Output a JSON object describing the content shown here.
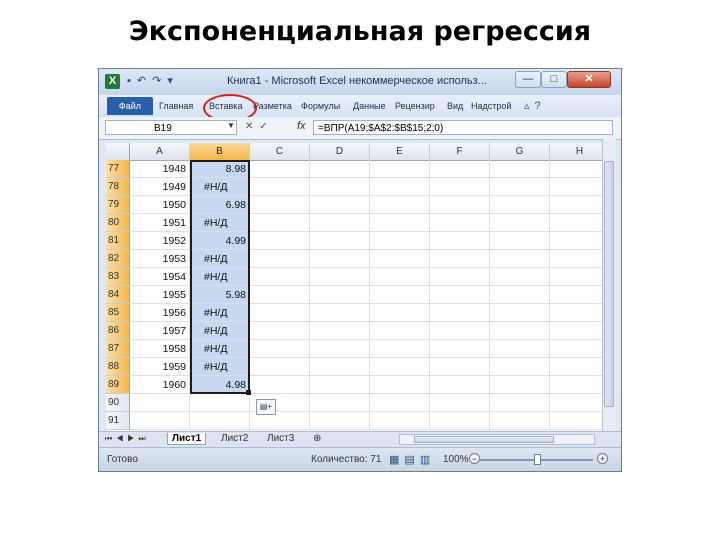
{
  "slide": {
    "title": "Экспоненциальная регрессия"
  },
  "window": {
    "title": "Книга1 - Microsoft Excel некоммерческое использ...",
    "app_icon": "excel-icon",
    "quick_access": [
      "save-icon",
      "undo-icon",
      "redo-icon",
      "dropdown-icon"
    ],
    "controls": {
      "minimize": "—",
      "maximize": "□",
      "close": "✕"
    }
  },
  "ribbon": {
    "file": "Файл",
    "tabs": [
      "Главная",
      "Вставка",
      "Разметка",
      "Формулы",
      "Данные",
      "Рецензир",
      "Вид",
      "Надстрой"
    ],
    "right_icons": [
      "help-icon",
      "minimize-ribbon-icon"
    ]
  },
  "formula_bar": {
    "name_box": "B19",
    "fx": "fx",
    "formula": "=ВПР(A19;$A$2:$B$15;2;0)"
  },
  "grid": {
    "columns": [
      "A",
      "B",
      "C",
      "D",
      "E",
      "F",
      "G",
      "H"
    ],
    "selected_column": "B",
    "rows": [
      {
        "row": "77",
        "a": "1948",
        "b": "8.98"
      },
      {
        "row": "78",
        "a": "1949",
        "b": "#Н/Д"
      },
      {
        "row": "79",
        "a": "1950",
        "b": "6.98"
      },
      {
        "row": "80",
        "a": "1951",
        "b": "#Н/Д"
      },
      {
        "row": "81",
        "a": "1952",
        "b": "4.99"
      },
      {
        "row": "82",
        "a": "1953",
        "b": "#Н/Д"
      },
      {
        "row": "83",
        "a": "1954",
        "b": "#Н/Д"
      },
      {
        "row": "84",
        "a": "1955",
        "b": "5.98"
      },
      {
        "row": "85",
        "a": "1956",
        "b": "#Н/Д"
      },
      {
        "row": "86",
        "a": "1957",
        "b": "#Н/Д"
      },
      {
        "row": "87",
        "a": "1958",
        "b": "#Н/Д"
      },
      {
        "row": "88",
        "a": "1959",
        "b": "#Н/Д"
      },
      {
        "row": "89",
        "a": "1960",
        "b": "4.98"
      },
      {
        "row": "90",
        "a": "",
        "b": ""
      },
      {
        "row": "91",
        "a": "",
        "b": ""
      }
    ],
    "paste_options_icon": "paste-options-icon"
  },
  "sheet_tabs": {
    "tabs": [
      "Лист1",
      "Лист2",
      "Лист3"
    ],
    "active": "Лист1",
    "new_sheet_icon": "insert-sheet-icon"
  },
  "status_bar": {
    "status": "Готово",
    "count": "Количество: 71",
    "zoom": "100%"
  },
  "colors": {
    "selection": "#c6d9f1",
    "header_highlight": "#f2b64b",
    "annotation_circle": "#d4201c",
    "file_tab": "#2b5ea8"
  }
}
